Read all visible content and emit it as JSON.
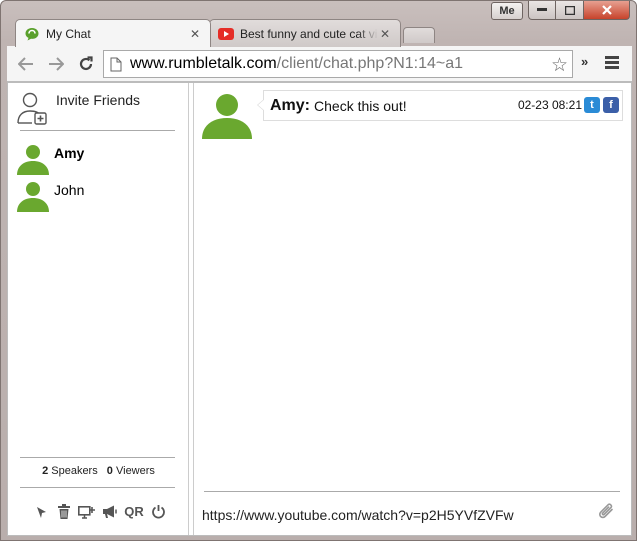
{
  "window": {
    "profile_label": "Me"
  },
  "tabs": [
    {
      "title": "My Chat",
      "active": true
    },
    {
      "title": "Best funny and cute cat vi",
      "active": false
    }
  ],
  "toolbar": {
    "url_host": "www.rumbletalk.com",
    "url_path": "/client/chat.php?N1:14~a1",
    "extensions_label": "»"
  },
  "sidebar": {
    "invite_label": "Invite Friends",
    "users": [
      {
        "name": "Amy",
        "active": true
      },
      {
        "name": "John",
        "active": false
      }
    ],
    "stats": {
      "speakers_count": "2",
      "speakers_label": "Speakers",
      "viewers_count": "0",
      "viewers_label": "Viewers"
    },
    "qr_label": "QR"
  },
  "chat": {
    "messages": [
      {
        "author": "Amy:",
        "text": "Check this out!",
        "time": "02-23 08:21"
      }
    ],
    "input_value": "https://www.youtube.com/watch?v=p2H5YVfZVFw"
  },
  "colors": {
    "avatar_green": "#6aa82f",
    "twitter_blue": "#2a8bd6",
    "facebook_blue": "#3b5fa8",
    "youtube_red": "#e52d27"
  }
}
